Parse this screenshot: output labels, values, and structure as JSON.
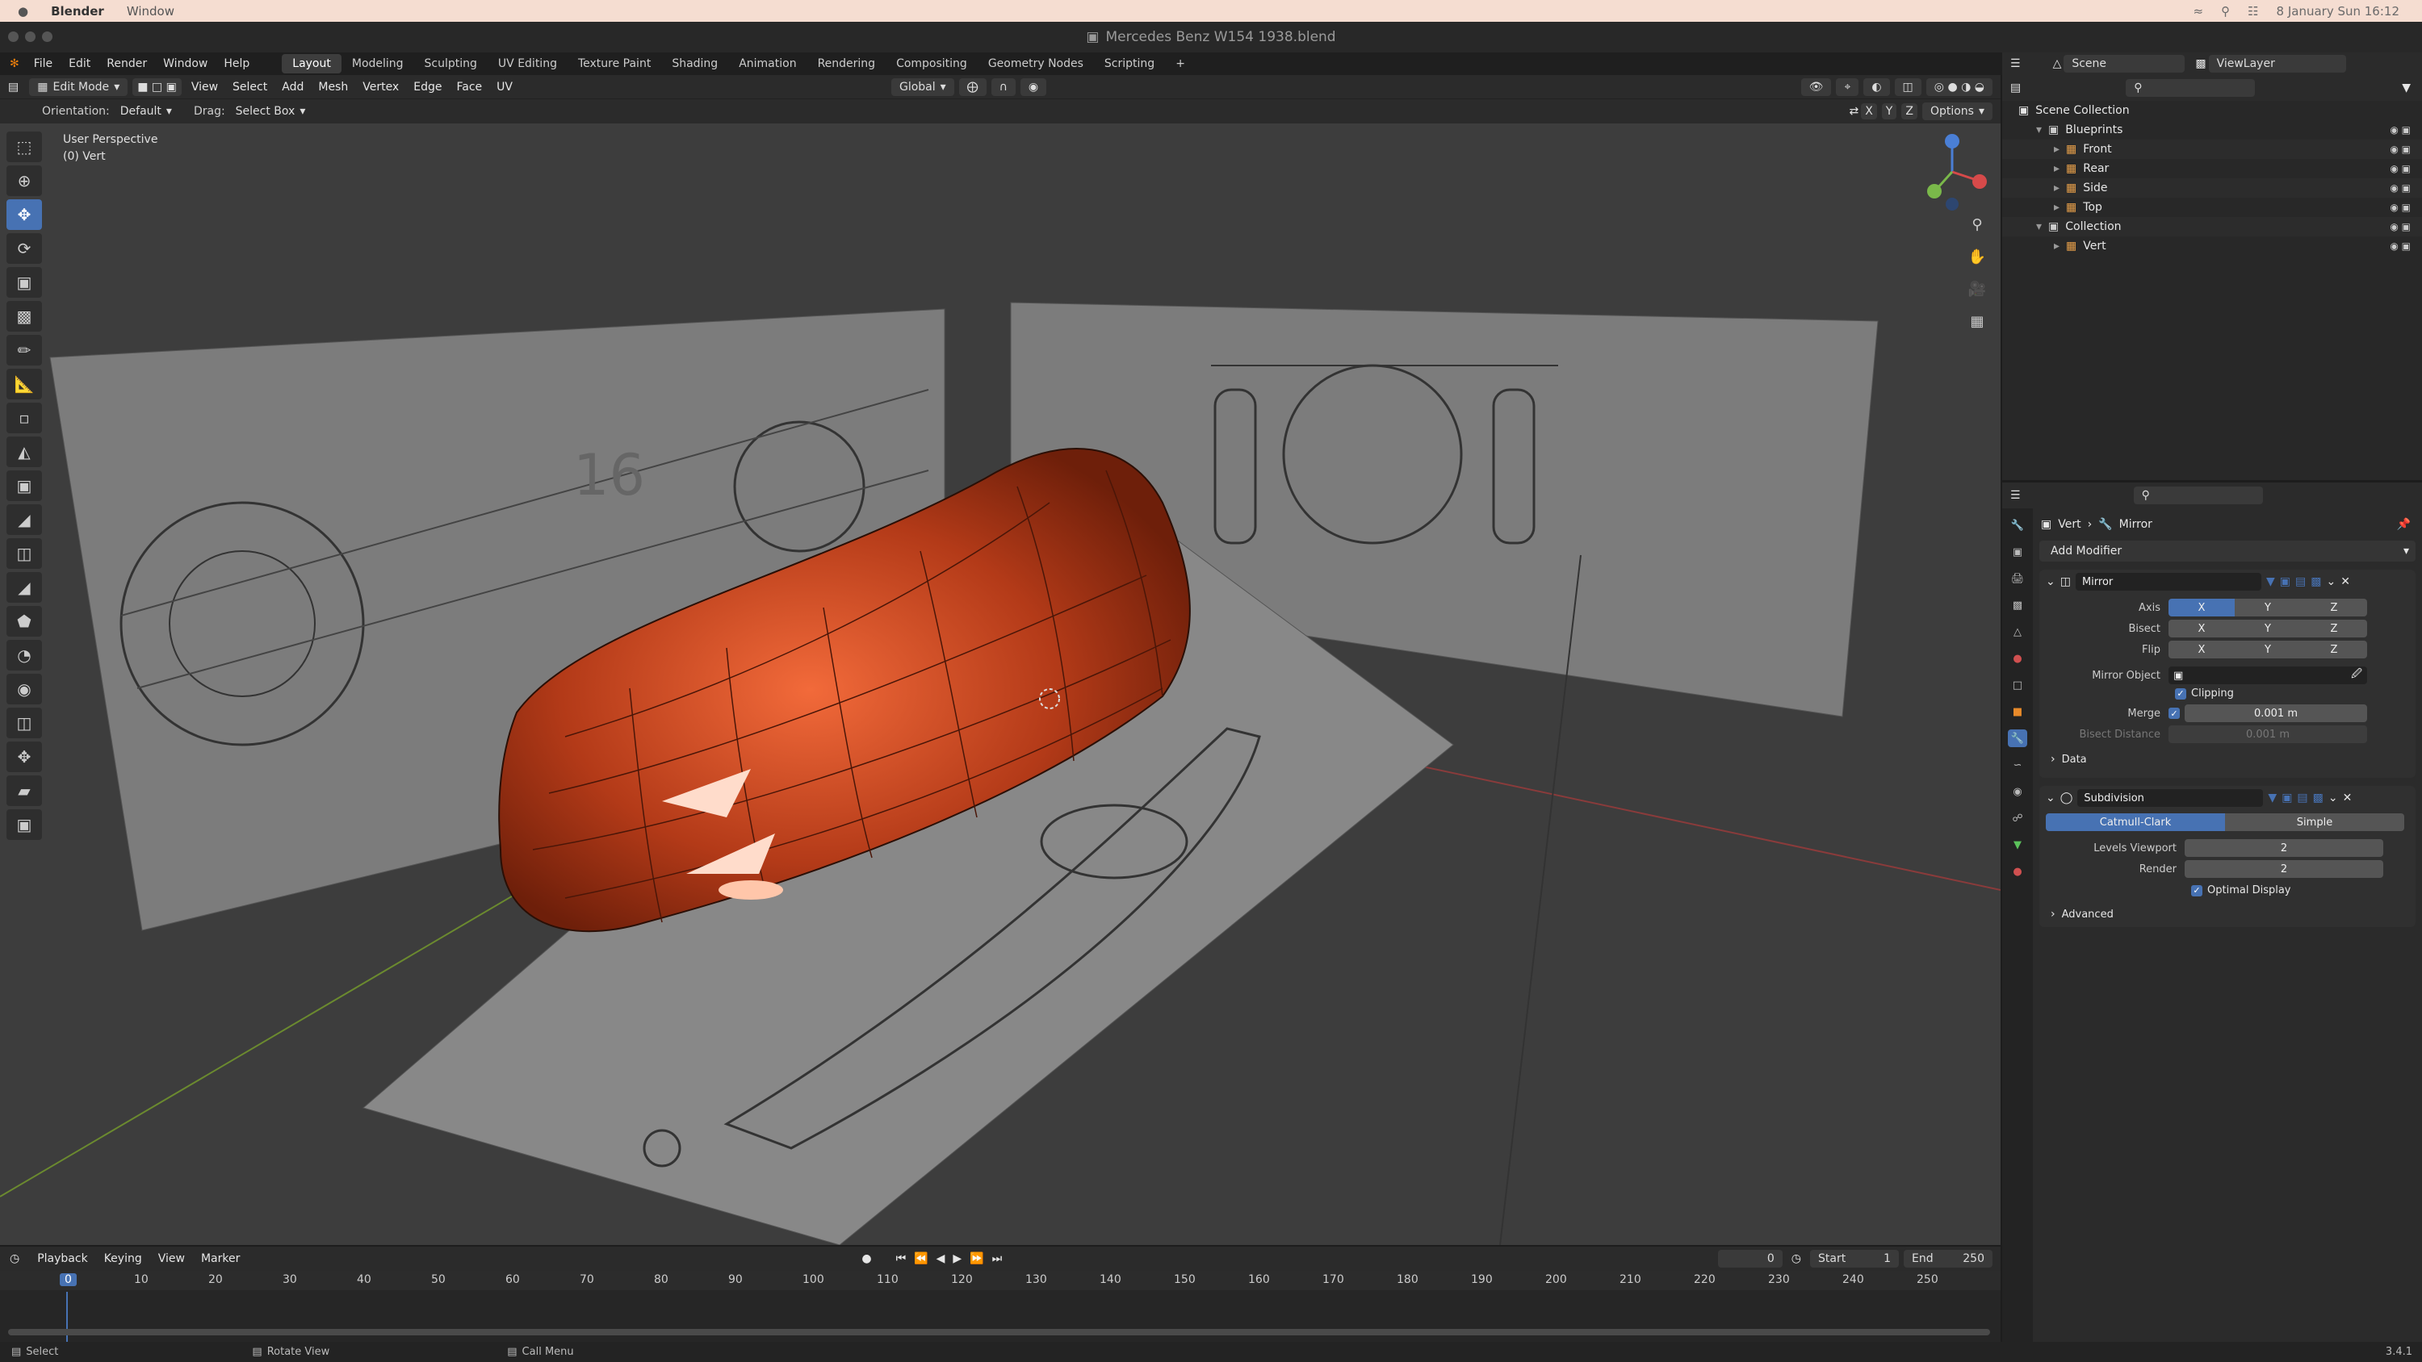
{
  "mac": {
    "app": "Blender",
    "menu": "Window",
    "datetime": "8 January Sun 16:12"
  },
  "window": {
    "title": "Mercedes Benz W154 1938.blend"
  },
  "menus": [
    "File",
    "Edit",
    "Render",
    "Window",
    "Help"
  ],
  "workspaces": [
    "Layout",
    "Modeling",
    "Sculpting",
    "UV Editing",
    "Texture Paint",
    "Shading",
    "Animation",
    "Rendering",
    "Compositing",
    "Geometry Nodes",
    "Scripting"
  ],
  "header": {
    "mode": "Edit Mode",
    "menus": [
      "View",
      "Select",
      "Add",
      "Mesh",
      "Vertex",
      "Edge",
      "Face",
      "UV"
    ],
    "transform": "Global",
    "orientation_label": "Orientation:",
    "orientation": "Default",
    "drag_label": "Drag:",
    "drag": "Select Box",
    "axes": [
      "X",
      "Y",
      "Z"
    ],
    "options": "Options"
  },
  "viewport": {
    "line1": "User Perspective",
    "line2": "(0) Vert"
  },
  "timeline": {
    "menus": [
      "Playback",
      "Keying",
      "View",
      "Marker"
    ],
    "current_frame": "0",
    "start_label": "Start",
    "start": "1",
    "end_label": "End",
    "end": "250",
    "ticks": [
      "0",
      "10",
      "20",
      "30",
      "40",
      "50",
      "60",
      "70",
      "80",
      "90",
      "100",
      "110",
      "120",
      "130",
      "140",
      "150",
      "160",
      "170",
      "180",
      "190",
      "200",
      "210",
      "220",
      "230",
      "240",
      "250"
    ]
  },
  "status": {
    "select": "Select",
    "rotate": "Rotate View",
    "menu": "Call Menu",
    "version": "3.4.1"
  },
  "outliner": {
    "scene": "Scene",
    "view_layer": "ViewLayer",
    "root": "Scene Collection",
    "items": [
      {
        "label": "Blueprints",
        "indent": 1
      },
      {
        "label": "Front",
        "indent": 2
      },
      {
        "label": "Rear",
        "indent": 2
      },
      {
        "label": "Side",
        "indent": 2
      },
      {
        "label": "Top",
        "indent": 2
      },
      {
        "label": "Collection",
        "indent": 1
      },
      {
        "label": "Vert",
        "indent": 2
      }
    ]
  },
  "properties": {
    "breadcrumb_object": "Vert",
    "breadcrumb_modifier": "Mirror",
    "add_modifier": "Add Modifier",
    "mirror": {
      "name": "Mirror",
      "axis_label": "Axis",
      "bisect_label": "Bisect",
      "flip_label": "Flip",
      "xyz": [
        "X",
        "Y",
        "Z"
      ],
      "mirror_object_label": "Mirror Object",
      "clipping": "Clipping",
      "merge_label": "Merge",
      "merge_value": "0.001 m",
      "bisect_distance_label": "Bisect Distance",
      "bisect_distance_value": "0.001 m",
      "data": "Data"
    },
    "subdivision": {
      "name": "Subdivision",
      "catmull": "Catmull-Clark",
      "simple": "Simple",
      "levels_label": "Levels Viewport",
      "levels_value": "2",
      "render_label": "Render",
      "render_value": "2",
      "optimal": "Optimal Display",
      "advanced": "Advanced"
    }
  },
  "colors": {
    "accent": "#4772b3",
    "body": "#c84a22",
    "viewport": "#3d3d3d"
  }
}
